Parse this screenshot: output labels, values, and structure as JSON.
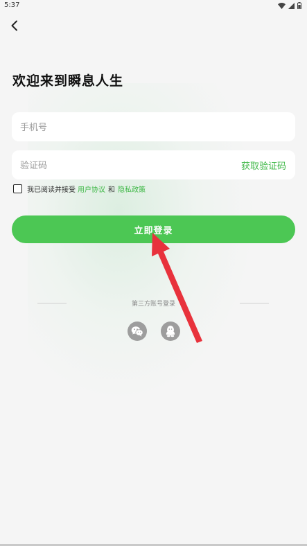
{
  "status_bar": {
    "time": "5:37"
  },
  "header": {
    "title": "欢迎来到瞬息人生"
  },
  "form": {
    "phone_placeholder": "手机号",
    "code_placeholder": "验证码",
    "get_code_label": "获取验证码"
  },
  "agreement": {
    "prefix": "我已阅读并接受",
    "user_agreement": "用户协议",
    "and": "和",
    "privacy_policy": "隐私政策",
    "checked": false
  },
  "login_button": {
    "label": "立即登录"
  },
  "third_party": {
    "label": "第三方账号登录",
    "options": [
      "wechat-icon",
      "qq-icon"
    ]
  },
  "colors": {
    "accent": "#4cc754",
    "link": "#3fb847",
    "annotation_arrow": "#e8323c",
    "background": "#f5f5f5"
  }
}
